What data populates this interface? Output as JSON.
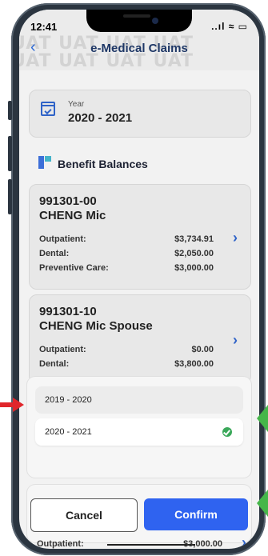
{
  "status": {
    "time": "12:41",
    "icons": "..ıl ≈ ▭"
  },
  "header": {
    "title": "e-Medical Claims",
    "watermark": "UAT UAT UAT UAT"
  },
  "year_card": {
    "label": "Year",
    "value": "2020 - 2021"
  },
  "section": {
    "title": "Benefit Balances"
  },
  "members": [
    {
      "id": "991301-00",
      "name": "CHENG Mic",
      "rows": [
        {
          "label": "Outpatient:",
          "value": "$3,734.91"
        },
        {
          "label": "Dental:",
          "value": "$2,050.00"
        },
        {
          "label": "Preventive Care:",
          "value": "$3,000.00"
        }
      ]
    },
    {
      "id": "991301-10",
      "name": "CHENG Mic Spouse",
      "rows": [
        {
          "label": "Outpatient:",
          "value": "$0.00"
        },
        {
          "label": "Dental:",
          "value": "$3,800.00"
        }
      ]
    }
  ],
  "picker": {
    "options": [
      {
        "label": "2019 - 2020",
        "selected": false
      },
      {
        "label": "2020 - 2021",
        "selected": true
      }
    ]
  },
  "actions": {
    "cancel": "Cancel",
    "confirm": "Confirm"
  },
  "peek": {
    "label": "Outpatient:",
    "value": "$3,000.00"
  },
  "colors": {
    "accent": "#2f63f0",
    "check": "#3aa85a",
    "marker_red": "#e0262b",
    "marker_green": "#45b649"
  }
}
